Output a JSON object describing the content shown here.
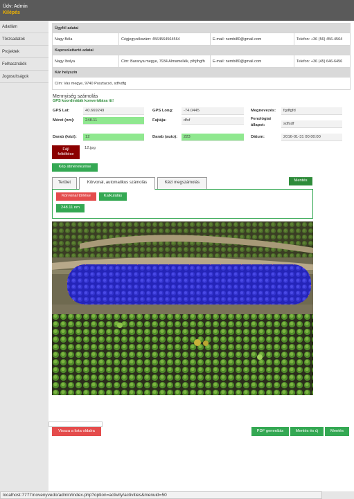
{
  "header": {
    "welcome": "Üdv: Admin",
    "logout": "Kilépés"
  },
  "sidebar": {
    "items": [
      "Adatlám",
      "Törzsadatok",
      "Projektek",
      "Felhasználók",
      "Jogosultságok"
    ]
  },
  "client_table": {
    "client_header": "Ügyfél adatai",
    "client_row": [
      "Nagy Béla",
      "Cégjegyzékszám: 4564564564564",
      "E-mail: nembi80@gmail.com",
      "Telefon: +36 (56) 456-4564"
    ],
    "contact_header": "Kapcsolattartó adatai",
    "contact_row": [
      "Nagy Ibolya",
      "Cím: Baranya megye, 7934 Almamellék, pfhjfhgfh",
      "E-mail: nembi80@gmail.com",
      "Telefon: +36 (45) 646-6456"
    ],
    "damage_header": "Kár helyszín",
    "damage_row": "Cím: Vas megye, 9740 Pusztacsó, sdfvdfg"
  },
  "form": {
    "title": "Mennyiség számolás",
    "gps_note": "GPS koordináták konvertálása itt!",
    "gps_lat_label": "GPS Lat:",
    "gps_lat": "40.669249",
    "gps_long_label": "GPS Long:",
    "gps_long": "-74.0445",
    "megnevezes_label": "Megnevezés:",
    "megnevezes": "fgdfgfd",
    "meret_label": "Méret (nm):",
    "meret": "248.11",
    "fajta_label": "Fajtája:",
    "fajta": "dfsf",
    "fenologiai_label_1": "Fenológiai",
    "fenologiai_label_2": "állapot:",
    "fenologiai": "sdfsdf",
    "darab_kezi_label": "Darab (kézi):",
    "darab_kezi": "12",
    "darab_auto_label": "Darab (auto):",
    "darab_auto": "223",
    "datum_label": "Dátum:",
    "datum": "2016-01-31 00:00:00",
    "file_button_1": "Fájl",
    "file_button_2": "feltöltése",
    "file_name": "12.jpg",
    "resize_button": "Kép átméretezése",
    "save_button_top": "Mentés"
  },
  "tabs": {
    "tab1": "Terület",
    "tab2": "Körvonal, automatikus számolás",
    "tab3": "Kézi megszámolás"
  },
  "tab_panel": {
    "delete_outline": "Körvonal törlése",
    "calculate": "Kalkulálás",
    "result": "248.11 nm"
  },
  "bottom": {
    "back": "Vissza a lista oldalra",
    "pdf": "PDF generálás",
    "save_new": "Mentés és új",
    "save": "Mentés"
  },
  "status_url": "localhost:7777/novenyvedo/admin/index.php?option=activity/activities&menuid=50",
  "colors": {
    "topbar": "#5a5a5a",
    "logout": "#f0b400",
    "green_button": "#34a853",
    "red_button": "#e44c4c",
    "dark_red_button": "#8b0000",
    "highlight_field": "#8fe88f",
    "selection_overlay": "#2a2acc"
  }
}
